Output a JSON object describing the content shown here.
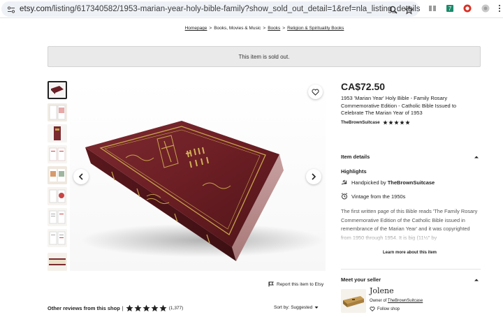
{
  "browser": {
    "url_host": "etsy.com",
    "url_path": "/listing/617340582/1953-marian-year-holy-bible-family?show_sold_out_detail=1&ref=nla_listing_details"
  },
  "breadcrumb": {
    "items": [
      "Homepage",
      "Books, Movies & Music",
      "Books",
      "Religion & Spirituality Books"
    ],
    "separator": ">"
  },
  "banner": {
    "text": "This item is sold out."
  },
  "gallery": {
    "report_label": "Report this item to Etsy"
  },
  "listing": {
    "price": "CA$72.50",
    "title": "1953 'Marian Year' Holy Bible - Family Rosary Commemorative Edition - Catholic Bible Issued to Celebrate The Marian Year of 1953",
    "shop_name": "TheBrownSuitcase",
    "rating": 5
  },
  "item_details": {
    "heading": "Item details",
    "highlights_label": "Highlights",
    "handpicked_prefix": "Handpicked by ",
    "handpicked_shop": "TheBrownSuitcase",
    "vintage": "Vintage from the 1950s",
    "description": "The first written page of this Bible reads 'The Family Rosary Commemorative Edition of the Catholic Bible issued in remembrance of the Marian Year' and it was copyrighted from 1950 through 1954. It is big (11½\" by",
    "learn_more": "Learn more about this item"
  },
  "seller": {
    "heading": "Meet your seller",
    "name": "Jolene",
    "owner_prefix": "Owner of ",
    "owner_shop": "TheBrownSuitcase",
    "follow_label": "Follow shop"
  },
  "reviews": {
    "title": "Other reviews from this shop",
    "separator": "|",
    "rating": 5,
    "count": "(1,377)",
    "sort_label": "Sort by: Suggested"
  },
  "colors": {
    "accent": "#222222",
    "banner_bg": "#eaeaea",
    "bible_leather": "#6b1e24",
    "gold": "#c9a44c"
  }
}
